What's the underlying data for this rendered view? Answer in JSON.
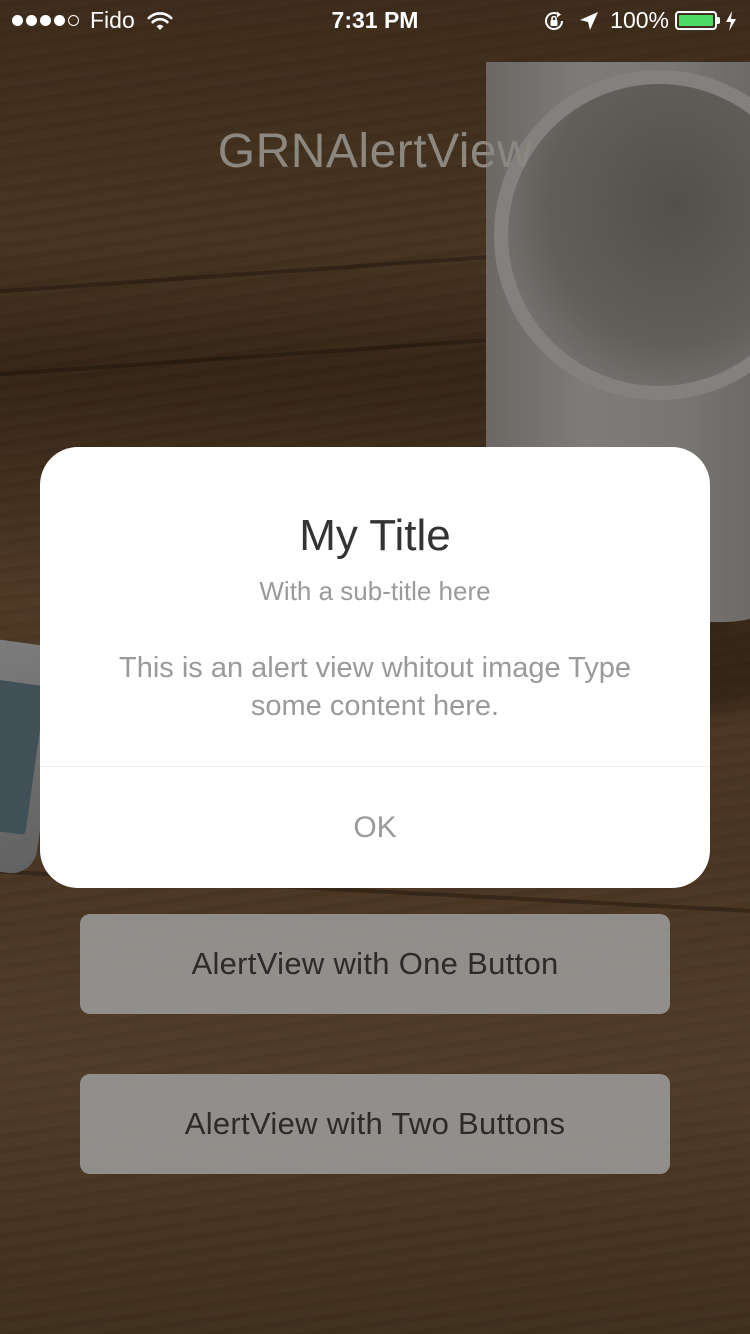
{
  "status_bar": {
    "carrier": "Fido",
    "time": "7:31 PM",
    "battery": "100%",
    "battery_level": 1.0,
    "battery_color": "#4cd964",
    "icons": [
      "signal-dots-icon",
      "wifi-icon",
      "orientation-lock-icon",
      "location-arrow-icon",
      "battery-icon",
      "charging-bolt-icon"
    ]
  },
  "app": {
    "title": "GRNAlertView",
    "buttons": {
      "one": "AlertView with One Button",
      "two": "AlertView with Two Buttons"
    }
  },
  "alert": {
    "title": "My Title",
    "subtitle": "With a sub-title here",
    "message": "This is an alert view whitout image Type some content here.",
    "ok": "OK"
  },
  "colors": {
    "alert_background": "#ffffff",
    "alert_text_muted": "#9a9a9a",
    "alert_title": "#333333"
  }
}
